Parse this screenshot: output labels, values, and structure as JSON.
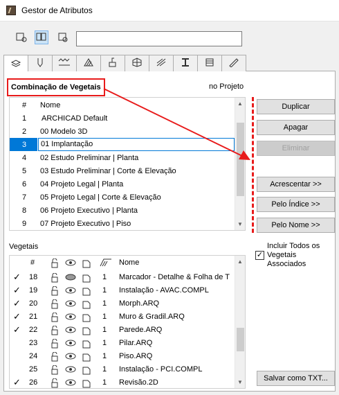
{
  "window": {
    "title": "Gestor de Atributos"
  },
  "search": {
    "value": ""
  },
  "view_buttons": [
    "view-left-icon",
    "view-both-icon",
    "view-right-icon"
  ],
  "tabs": [
    "layers-icon",
    "pen-icon",
    "line-type-icon",
    "fill-icon",
    "paint-icon",
    "building-material-icon",
    "surface-icon",
    "profile-icon",
    "composite-icon",
    "pen-set-icon"
  ],
  "combination": {
    "label": "Combinação de Vegetais",
    "in_project_label": "no Projeto",
    "columns": {
      "num": "#",
      "name": "Nome"
    },
    "rows": [
      {
        "num": "1",
        "name": "ARCHICAD Default"
      },
      {
        "num": "2",
        "name": "00 Modelo 3D"
      },
      {
        "num": "3",
        "name": "01 Implantação",
        "selected": true
      },
      {
        "num": "4",
        "name": "02 Estudo Preliminar | Planta"
      },
      {
        "num": "5",
        "name": "03 Estudo Preliminar | Corte & Elevação"
      },
      {
        "num": "6",
        "name": "04 Projeto Legal | Planta"
      },
      {
        "num": "7",
        "name": "05 Projeto Legal | Corte & Elevação"
      },
      {
        "num": "8",
        "name": "06 Projeto Executivo | Planta"
      },
      {
        "num": "9",
        "name": "07 Projeto Executivo | Piso"
      }
    ]
  },
  "buttons": {
    "duplicate": "Duplicar",
    "delete": "Apagar",
    "remove": "Eliminar",
    "append": "Acrescentar >>",
    "by_index": "Pelo Índice >>",
    "by_name": "Pelo Nome >>",
    "save_txt": "Salvar como TXT..."
  },
  "layers": {
    "label": "Vegetais",
    "columns": {
      "num": "#",
      "name": "Nome"
    },
    "rows": [
      {
        "checked": true,
        "num": "18",
        "pen": "1",
        "name": "Marcador - Detalhe & Folha de T"
      },
      {
        "checked": true,
        "num": "19",
        "pen": "1",
        "name": "Instalação - AVAC.COMPL"
      },
      {
        "checked": true,
        "num": "20",
        "pen": "1",
        "name": "Morph.ARQ"
      },
      {
        "checked": true,
        "num": "21",
        "pen": "1",
        "name": "Muro & Gradil.ARQ"
      },
      {
        "checked": true,
        "num": "22",
        "pen": "1",
        "name": "Parede.ARQ"
      },
      {
        "checked": false,
        "num": "23",
        "pen": "1",
        "name": "Pilar.ARQ"
      },
      {
        "checked": false,
        "num": "24",
        "pen": "1",
        "name": "Piso.ARQ"
      },
      {
        "checked": false,
        "num": "25",
        "pen": "1",
        "name": "Instalação - PCI.COMPL"
      },
      {
        "checked": true,
        "num": "26",
        "pen": "1",
        "name": "Revisão.2D"
      }
    ]
  },
  "include_all": {
    "checked": true,
    "label": "Incluir Todos os Vegetais Associados"
  },
  "colors": {
    "accent": "#e81b1b",
    "selection": "#0078d7"
  }
}
